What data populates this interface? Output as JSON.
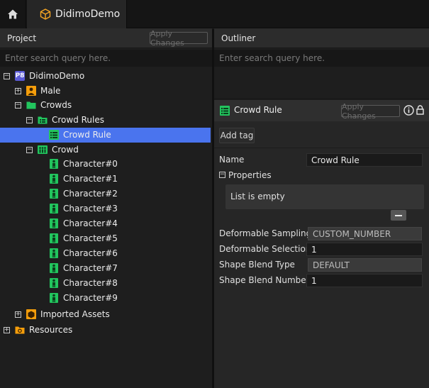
{
  "tabs": {
    "home": {
      "icon": "home-icon"
    },
    "active": {
      "label": "DidimoDemo",
      "icon": "cube-icon"
    }
  },
  "project": {
    "title": "Project",
    "apply_label": "Apply Changes",
    "search_placeholder": "Enter search query here.",
    "tree": [
      {
        "label": "DidimoDemo",
        "expander": "−",
        "icon": "p8-badge-icon",
        "badge_text": "P8"
      },
      {
        "label": "Male",
        "expander": "+",
        "icon": "character-folder-icon"
      },
      {
        "label": "Crowds",
        "expander": "−",
        "icon": "folder-icon"
      },
      {
        "label": "Crowd Rules",
        "expander": "−",
        "icon": "rules-folder-icon"
      },
      {
        "label": "Crowd Rule",
        "icon": "crowd-rule-icon"
      },
      {
        "label": "Crowd",
        "expander": "−",
        "icon": "crowd-icon"
      },
      {
        "label": "Character#0",
        "icon": "character-icon"
      },
      {
        "label": "Character#1",
        "icon": "character-icon"
      },
      {
        "label": "Character#2",
        "icon": "character-icon"
      },
      {
        "label": "Character#3",
        "icon": "character-icon"
      },
      {
        "label": "Character#4",
        "icon": "character-icon"
      },
      {
        "label": "Character#5",
        "icon": "character-icon"
      },
      {
        "label": "Character#6",
        "icon": "character-icon"
      },
      {
        "label": "Character#7",
        "icon": "character-icon"
      },
      {
        "label": "Character#8",
        "icon": "character-icon"
      },
      {
        "label": "Character#9",
        "icon": "character-icon"
      },
      {
        "label": "Imported Assets",
        "expander": "+",
        "icon": "imported-assets-icon"
      },
      {
        "label": "Resources",
        "expander": "+",
        "icon": "resources-icon"
      }
    ]
  },
  "outliner": {
    "title": "Outliner",
    "search_placeholder": "Enter search query here."
  },
  "properties": {
    "title": "Crowd Rule",
    "apply_label": "Apply Changes",
    "add_tag_label": "Add tag",
    "name_label": "Name",
    "name_value": "Crowd Rule",
    "section_label": "Properties",
    "section_expander": "−",
    "list_empty": "List is empty",
    "fields": [
      {
        "label": "Deformable Sampling",
        "value": "CUSTOM_NUMBER",
        "readonly": true
      },
      {
        "label": "Deformable Selection",
        "value": "1",
        "readonly": false
      },
      {
        "label": "Shape Blend Type",
        "value": "DEFAULT",
        "readonly": true
      },
      {
        "label": "Shape Blend Number",
        "value": "1",
        "readonly": false
      }
    ]
  },
  "colors": {
    "selection": "#4a74ee",
    "icon_green": "#22c55e",
    "icon_orange": "#f59e0b",
    "p8_badge": "#5b5bd6"
  }
}
